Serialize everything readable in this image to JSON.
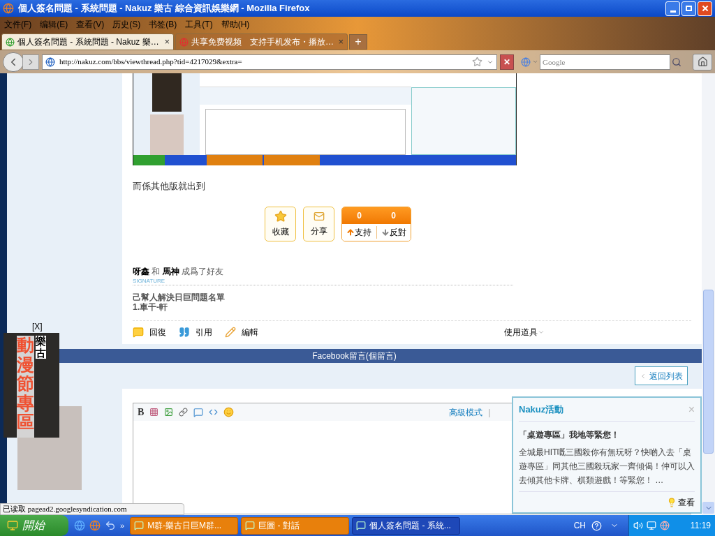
{
  "window": {
    "title": "個人簽名問題 - 系統問題 - Nakuz 樂古 綜合資訊娛樂網 - Mozilla Firefox"
  },
  "menu": [
    "文件(F)",
    "编辑(E)",
    "查看(V)",
    "历史(S)",
    "书签(B)",
    "工具(T)",
    "帮助(H)"
  ],
  "tabs": [
    {
      "label": "個人簽名問題 - 系統問題 - Nakuz 樂…",
      "selected": true,
      "close": "×"
    },
    {
      "label": "共享免费视频　支持手机发布・播放…",
      "selected": false,
      "close": "×"
    }
  ],
  "new_tab": "+",
  "address": {
    "url": "http://nakuz.com/bbs/viewthread.php?tid=4217029&extra="
  },
  "stop": "✕",
  "search": {
    "placeholder": "Google"
  },
  "post": {
    "text": "而係其他版就出到",
    "actions": [
      {
        "label": "收藏",
        "kind": "star"
      },
      {
        "label": "分享",
        "kind": "mail"
      }
    ],
    "votes": [
      {
        "count": "0",
        "label": "支持",
        "kind": "up"
      },
      {
        "count": "0",
        "label": "反對",
        "kind": "down"
      }
    ],
    "activity": "**呀鑫** 和 **馬神** 成爲了好友",
    "signature_label": "SIGNATURE",
    "signature": [
      "己幫人解決日巨問題名單",
      "1.車干-軒"
    ],
    "footer": [
      {
        "label": "回復",
        "kind": "reply"
      },
      {
        "label": "引用",
        "kind": "quote"
      },
      {
        "label": "編輯",
        "kind": "edit"
      }
    ],
    "tools": "使用道具"
  },
  "facebook_bar": "Facebook留言(個留言)",
  "back_button": "返回列表",
  "editor": {
    "bold": "B",
    "advanced": "高級模式",
    "divider": "|"
  },
  "ad": {
    "close": "[X]",
    "brand": "樂古",
    "title": "動漫節專區"
  },
  "status_text": "已读取 pagead2.googlesyndication.com",
  "popup": {
    "title": "Nakuz活動",
    "close": "×",
    "heading": "「桌遊專區」我地等緊您！",
    "body": "全城最HIT嘅三國殺你有無玩呀？快啲入去「桌遊專區」同其他三國殺玩家一齊傾偈！仲可以入去傾其他卡牌、棋類遊戲！等緊您！ …",
    "link": "查看"
  },
  "taskbar": {
    "start": "開始",
    "more": "»",
    "tasks": [
      {
        "label": "M群-樂古日巨M群...",
        "selected": false
      },
      {
        "label": "巨圖 - 對話",
        "selected": false
      },
      {
        "label": "個人簽名問題 - 系統...",
        "selected": true
      }
    ],
    "lang": "CH",
    "clock": "11:19"
  }
}
